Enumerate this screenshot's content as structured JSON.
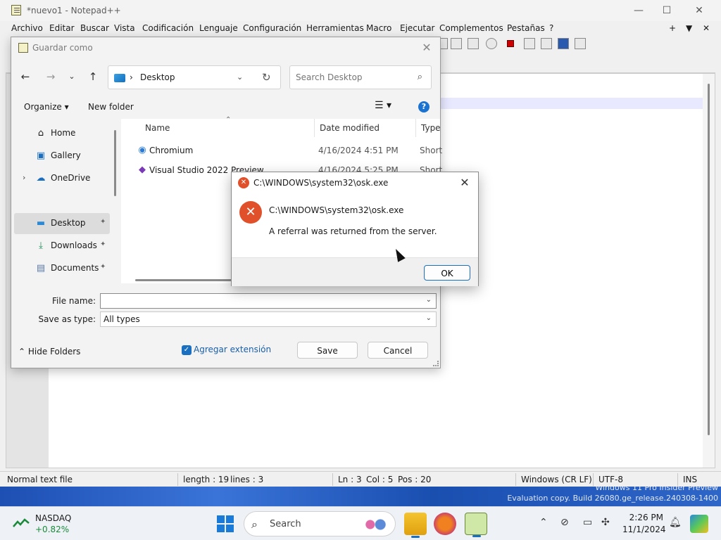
{
  "notepad": {
    "title": "*nuevo1 - Notepad++",
    "menu": [
      "Archivo",
      "Editar",
      "Buscar",
      "Vista",
      "Codificación",
      "Lenguaje",
      "Configuración",
      "Herramientas",
      "Macro",
      "Ejecutar",
      "Complementos",
      "Pestañas",
      "?"
    ],
    "menu_right": [
      "+",
      "▼",
      "✕"
    ],
    "status": {
      "file_type": "Normal text file",
      "length": "length : 19",
      "lines": "lines : 3",
      "ln": "Ln : 3",
      "col": "Col : 5",
      "pos": "Pos : 20",
      "eol": "Windows (CR LF)",
      "encoding": "UTF-8",
      "mode": "INS"
    }
  },
  "save_dialog": {
    "title": "Guardar como",
    "breadcrumb": "Desktop",
    "search_placeholder": "Search Desktop",
    "organize": "Organize ▾",
    "new_folder": "New folder",
    "nav": [
      {
        "label": "Home",
        "icon": "home-icon"
      },
      {
        "label": "Gallery",
        "icon": "gallery-icon"
      },
      {
        "label": "OneDrive",
        "icon": "onedrive-icon"
      },
      {
        "label": "Desktop",
        "icon": "desktop-icon",
        "selected": true
      },
      {
        "label": "Downloads",
        "icon": "download-icon"
      },
      {
        "label": "Documents",
        "icon": "documents-icon"
      }
    ],
    "columns": {
      "name": "Name",
      "date": "Date modified",
      "type": "Type"
    },
    "files": [
      {
        "name": "Chromium",
        "date": "4/16/2024 4:51 PM",
        "type": "Short"
      },
      {
        "name": "Visual Studio 2022 Preview",
        "date": "4/16/2024 5:25 PM",
        "type": "Short"
      }
    ],
    "file_name_label": "File name:",
    "file_name_value": "",
    "save_type_label": "Save as type:",
    "save_type_value": "All types",
    "hide_folders": "Hide Folders",
    "add_extension": "Agregar extensión",
    "save": "Save",
    "cancel": "Cancel"
  },
  "error_dialog": {
    "title": "C:\\WINDOWS\\system32\\osk.exe",
    "line1": "C:\\WINDOWS\\system32\\osk.exe",
    "line2": "A referral was returned from the server.",
    "ok": "OK"
  },
  "desktop": {
    "watermark1": "Windows 11 Pro Insider Preview",
    "watermark2": "Evaluation copy. Build 26080.ge_release.240308-1400"
  },
  "taskbar": {
    "ticker_name": "NASDAQ",
    "ticker_change": "+0.82%",
    "search": "Search",
    "time": "2:26 PM",
    "date": "11/1/2024"
  },
  "colors": {
    "accent": "#1a6fc0",
    "error": "#e0502a",
    "gain": "#1a8a3a"
  }
}
